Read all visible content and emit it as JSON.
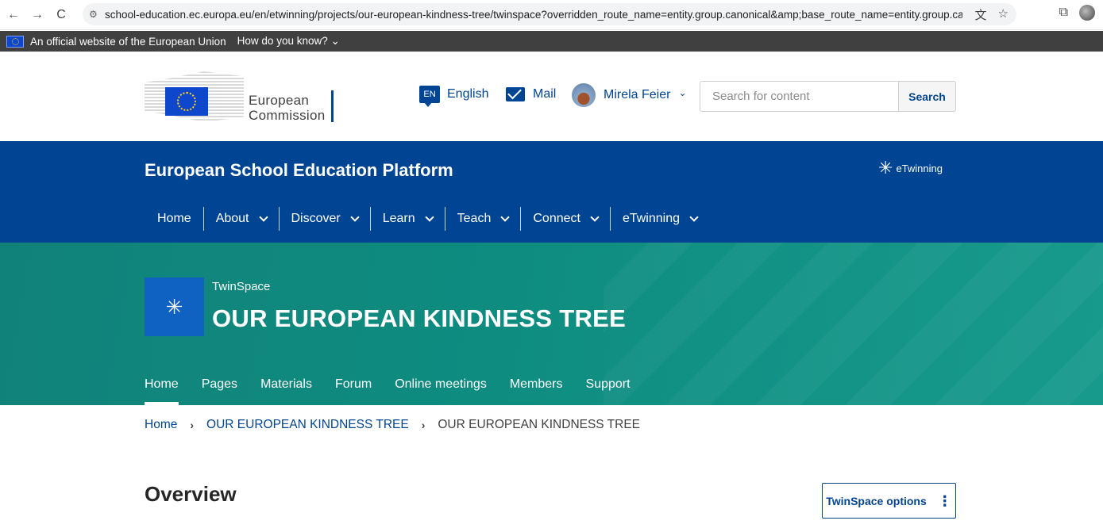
{
  "browser": {
    "url": "school-education.ec.europa.eu/en/etwinning/projects/our-european-kindness-tree/twinspace?overridden_route_name=entity.group.canonical&amp;base_route_name=entity.group.canon...",
    "back_icon": "←",
    "forward_icon": "→",
    "reload_icon": "C",
    "site_info_icon": "⚙",
    "translate_icon": "文",
    "star_icon": "☆",
    "extensions_icon": "⧉"
  },
  "eu_banner": {
    "official_text": "An official website of the European Union",
    "how_text": "How do you know?"
  },
  "header": {
    "logo_line1": "European",
    "logo_line2": "Commission",
    "lang_code": "EN",
    "lang_label": "English",
    "mail_label": "Mail",
    "user_name": "Mirela Feier",
    "search_placeholder": "Search for content",
    "search_button": "Search"
  },
  "platform": {
    "title": "European School Education Platform",
    "etwinning_logo": "eTwinning",
    "nav": [
      {
        "label": "Home",
        "has_menu": false
      },
      {
        "label": "About",
        "has_menu": true
      },
      {
        "label": "Discover",
        "has_menu": true
      },
      {
        "label": "Learn",
        "has_menu": true
      },
      {
        "label": "Teach",
        "has_menu": true
      },
      {
        "label": "Connect",
        "has_menu": true
      },
      {
        "label": "eTwinning",
        "has_menu": true
      }
    ]
  },
  "project": {
    "space_label": "TwinSpace",
    "title": "OUR EUROPEAN KINDNESS TREE",
    "tabs": [
      "Home",
      "Pages",
      "Materials",
      "Forum",
      "Online meetings",
      "Members",
      "Support"
    ],
    "active_tab": "Home"
  },
  "breadcrumb": {
    "items": [
      "Home",
      "OUR EUROPEAN KINDNESS TREE",
      "OUR EUROPEAN KINDNESS TREE"
    ],
    "separator": "›"
  },
  "content": {
    "heading": "Overview",
    "options_button": "TwinSpace options",
    "options_icon": "⋮"
  }
}
